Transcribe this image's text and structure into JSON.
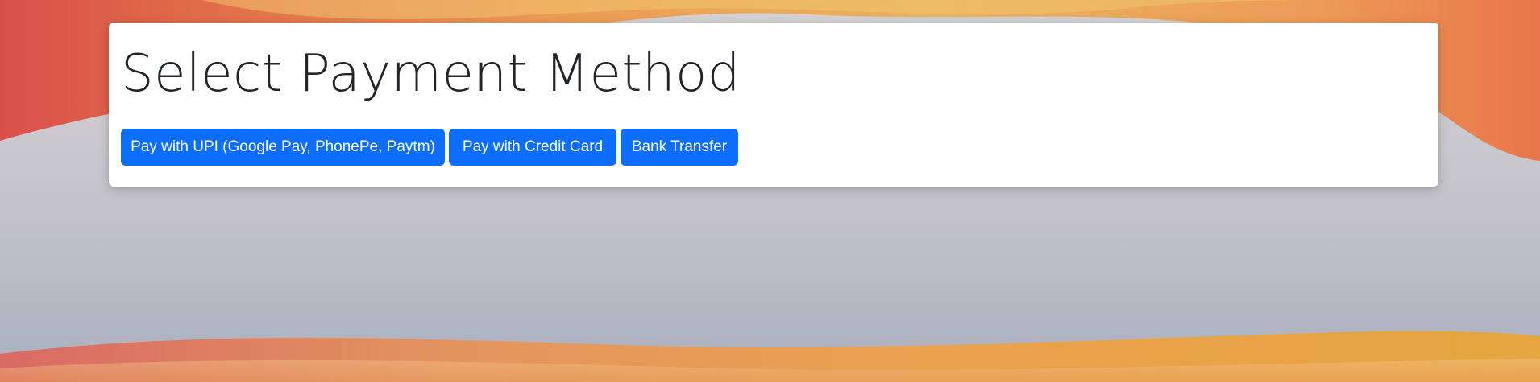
{
  "page": {
    "title": "Select Payment Method"
  },
  "payment_options": [
    {
      "label": "Pay with UPI (Google Pay, PhonePe, Paytm)"
    },
    {
      "label": "Pay with Credit Card"
    },
    {
      "label": "Bank Transfer"
    }
  ],
  "colors": {
    "button_primary": "#0d6efd",
    "button_text": "#ffffff",
    "panel_background": "#ffffff",
    "heading_text": "#212529"
  }
}
